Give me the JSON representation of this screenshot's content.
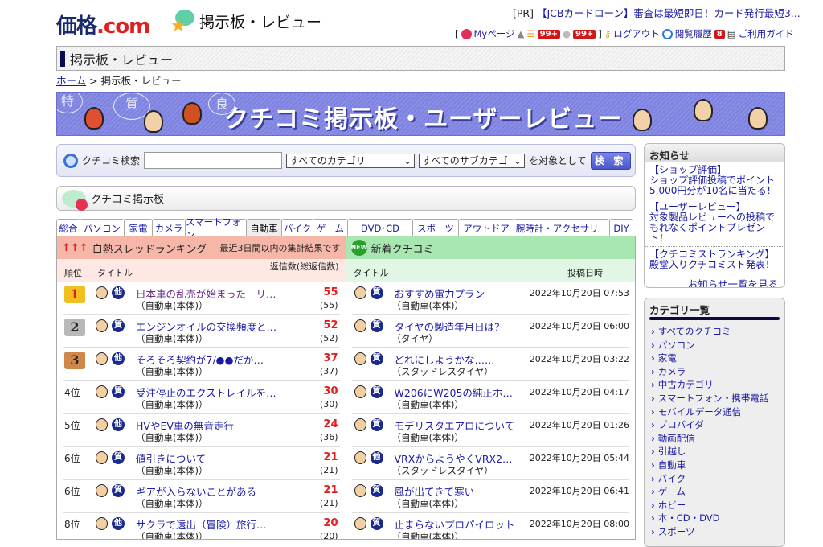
{
  "header": {
    "logo": "価格.com",
    "logo_main": "価格",
    "logo_dot": ".com",
    "bbs_title": "掲示板・レビュー",
    "pr_tag": "[PR]",
    "pr_text": "【JCBカードローン】審査は最短即日！カード発行最短3...",
    "user": {
      "open": "[",
      "mypage": "Myページ",
      "badge1": "99+",
      "badge2": "99+",
      "close": "]",
      "logout": "ログアウト",
      "history": "閲覧履歴",
      "history_badge": "8",
      "guide": "ご利用ガイド"
    }
  },
  "titlebar": "掲示板・レビュー",
  "breadcrumb": {
    "home": "ホーム",
    "sep": ">",
    "current": "掲示板・レビュー"
  },
  "banner": {
    "title": "クチコミ掲示板・ユーザーレビュー",
    "bubbles": [
      "特",
      "質",
      "良"
    ]
  },
  "search": {
    "label": "クチコミ検索",
    "value": "",
    "category": "すべてのカテゴリ",
    "subcategory": "すべてのサブカテゴ",
    "suffix": "を対象として",
    "button": "検 索"
  },
  "board_title": "クチコミ掲示板",
  "tabs": [
    "総合",
    "パソコン",
    "家電",
    "カメラ",
    "スマートフォン",
    "自動車",
    "バイク",
    "ゲーム",
    "DVD･CD",
    "スポーツ",
    "アウトドア",
    "腕時計・アクセサリー",
    "DIY"
  ],
  "active_tab": "自動車",
  "ranking": {
    "title": "白熱スレッドランキング",
    "note": "最近3日間以内の集計結果です",
    "col_rank": "順位",
    "col_title": "タイトル",
    "col_count": "返信数(総返信数)",
    "rows": [
      {
        "rank": "1",
        "title": "日本車の乱売が始まった　リ…",
        "cat": "（自動車(本体)）",
        "type": "他",
        "count": "55",
        "total": "(55)"
      },
      {
        "rank": "2",
        "title": "エンジンオイルの交換頻度と…",
        "cat": "（自動車(本体)）",
        "type": "質",
        "count": "52",
        "total": "(52)"
      },
      {
        "rank": "3",
        "title": "そろそろ契約が7/●●だか…",
        "cat": "（自動車(本体)）",
        "type": "他",
        "count": "37",
        "total": "(37)"
      },
      {
        "rank": "4位",
        "title": "受注停止のエクストレイルを…",
        "cat": "（自動車(本体)）",
        "type": "質",
        "count": "30",
        "total": "(30)"
      },
      {
        "rank": "5位",
        "title": "HVやEV車の無音走行",
        "cat": "（自動車(本体)）",
        "type": "他",
        "count": "24",
        "total": "(36)"
      },
      {
        "rank": "6位",
        "title": "値引きについて",
        "cat": "（自動車(本体)）",
        "type": "質",
        "count": "21",
        "total": "(21)"
      },
      {
        "rank": "6位",
        "title": "ギアが入らないことがある",
        "cat": "（自動車(本体)）",
        "type": "質",
        "count": "21",
        "total": "(21)"
      },
      {
        "rank": "8位",
        "title": "サクラで遠出（冒険）旅行…",
        "cat": "（自動車(本体)）",
        "type": "他",
        "count": "20",
        "total": "(20)"
      }
    ]
  },
  "latest": {
    "title": "新着クチコミ",
    "new_badge": "NEW",
    "col_title": "タイトル",
    "col_date": "投稿日時",
    "rows": [
      {
        "title": "おすすめ電力プラン",
        "cat": "（自動車(本体)）",
        "type": "質",
        "date": "2022年10月20日 07:53"
      },
      {
        "title": "タイヤの製造年月日は？",
        "cat": "（タイヤ）",
        "type": "質",
        "date": "2022年10月20日 06:00"
      },
      {
        "title": "どれにしようかな……",
        "cat": "（スタッドレスタイヤ）",
        "type": "質",
        "date": "2022年10月20日 03:22"
      },
      {
        "title": "W206にW205の純正ホ…",
        "cat": "（自動車(本体)）",
        "type": "質",
        "date": "2022年10月20日 04:17"
      },
      {
        "title": "モデリスタエアロについて",
        "cat": "（自動車(本体)）",
        "type": "質",
        "date": "2022年10月20日 01:26"
      },
      {
        "title": "VRXからようやくVRX2…",
        "cat": "（スタッドレスタイヤ）",
        "type": "他",
        "date": "2022年10月20日 05:44"
      },
      {
        "title": "風が出てきて寒い",
        "cat": "（自動車(本体)）",
        "type": "質",
        "date": "2022年10月20日 06:41"
      },
      {
        "title": "止まらないプロパイロット",
        "cat": "（自動車(本体)）",
        "type": "質",
        "date": "2022年10月20日 08:00"
      }
    ]
  },
  "news": {
    "title": "お知らせ",
    "items": [
      [
        "【ショップ評価】",
        "ショップ評価投稿でポイント",
        "5,000円分が10名に当たる！"
      ],
      [
        "【ユーザーレビュー】",
        "対象製品レビューへの投稿で",
        "もれなくポイントプレゼント！"
      ],
      [
        "【クチコミストランキング】",
        "殿堂入りクチコミスト発表！"
      ]
    ],
    "more": "お知らせ一覧を見る"
  },
  "categories": {
    "title": "カテゴリ一覧",
    "items": [
      "すべてのクチコミ",
      "パソコン",
      "家電",
      "カメラ",
      "中古カテゴリ",
      "スマートフォン・携帯電話",
      "モバイルデータ通信",
      "プロバイダ",
      "動画配信",
      "引越し",
      "自動車",
      "バイク",
      "ゲーム",
      "ホビー",
      "本・CD・DVD",
      "スポーツ"
    ]
  },
  "colors": {
    "link": "#1a1aa6",
    "ranking_header": "#f7b7a8",
    "latest_header": "#a8e6b2",
    "count": "#e02020",
    "banner": "#8a8ee6"
  }
}
